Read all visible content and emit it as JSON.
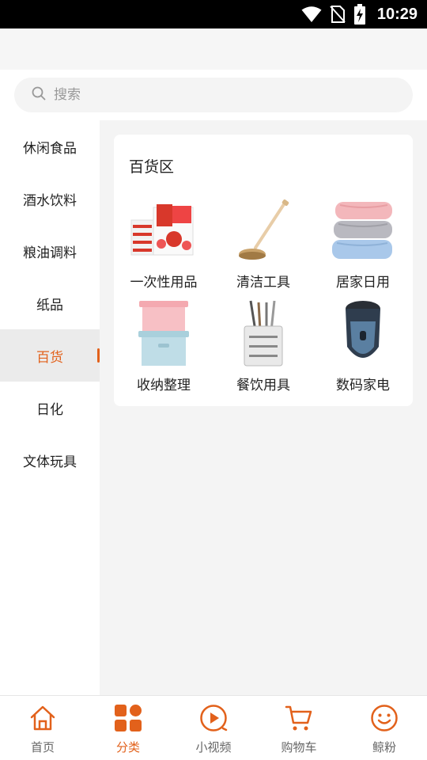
{
  "status_bar": {
    "time": "10:29",
    "icons": [
      "wifi-icon",
      "no-sim-icon",
      "battery-charging-icon"
    ]
  },
  "search": {
    "placeholder": "搜索",
    "icon": "search-icon"
  },
  "sidebar": {
    "items": [
      {
        "label": "休闲食品",
        "active": false
      },
      {
        "label": "酒水饮料",
        "active": false
      },
      {
        "label": "粮油调料",
        "active": false
      },
      {
        "label": "纸品",
        "active": false
      },
      {
        "label": "百货",
        "active": true
      },
      {
        "label": "日化",
        "active": false
      },
      {
        "label": "文体玩具",
        "active": false
      }
    ]
  },
  "category_panel": {
    "title": "百货区",
    "items": [
      {
        "label": "一次性用品",
        "image": "disposable-cups-image"
      },
      {
        "label": "清洁工具",
        "image": "cleaning-brush-image"
      },
      {
        "label": "居家日用",
        "image": "towels-image"
      },
      {
        "label": "收纳整理",
        "image": "storage-box-image"
      },
      {
        "label": "餐饮用具",
        "image": "utensil-holder-image"
      },
      {
        "label": "数码家电",
        "image": "electric-shaver-image"
      }
    ]
  },
  "bottom_nav": {
    "items": [
      {
        "label": "首页",
        "icon": "home-icon",
        "active": false
      },
      {
        "label": "分类",
        "icon": "category-grid-icon",
        "active": true
      },
      {
        "label": "小视频",
        "icon": "play-icon",
        "active": false
      },
      {
        "label": "购物车",
        "icon": "cart-icon",
        "active": false
      },
      {
        "label": "鲸粉",
        "icon": "smiley-icon",
        "active": false
      }
    ]
  },
  "colors": {
    "accent": "#e2611b",
    "background": "#f4f4f4",
    "text": "#222222",
    "muted": "#666666"
  }
}
